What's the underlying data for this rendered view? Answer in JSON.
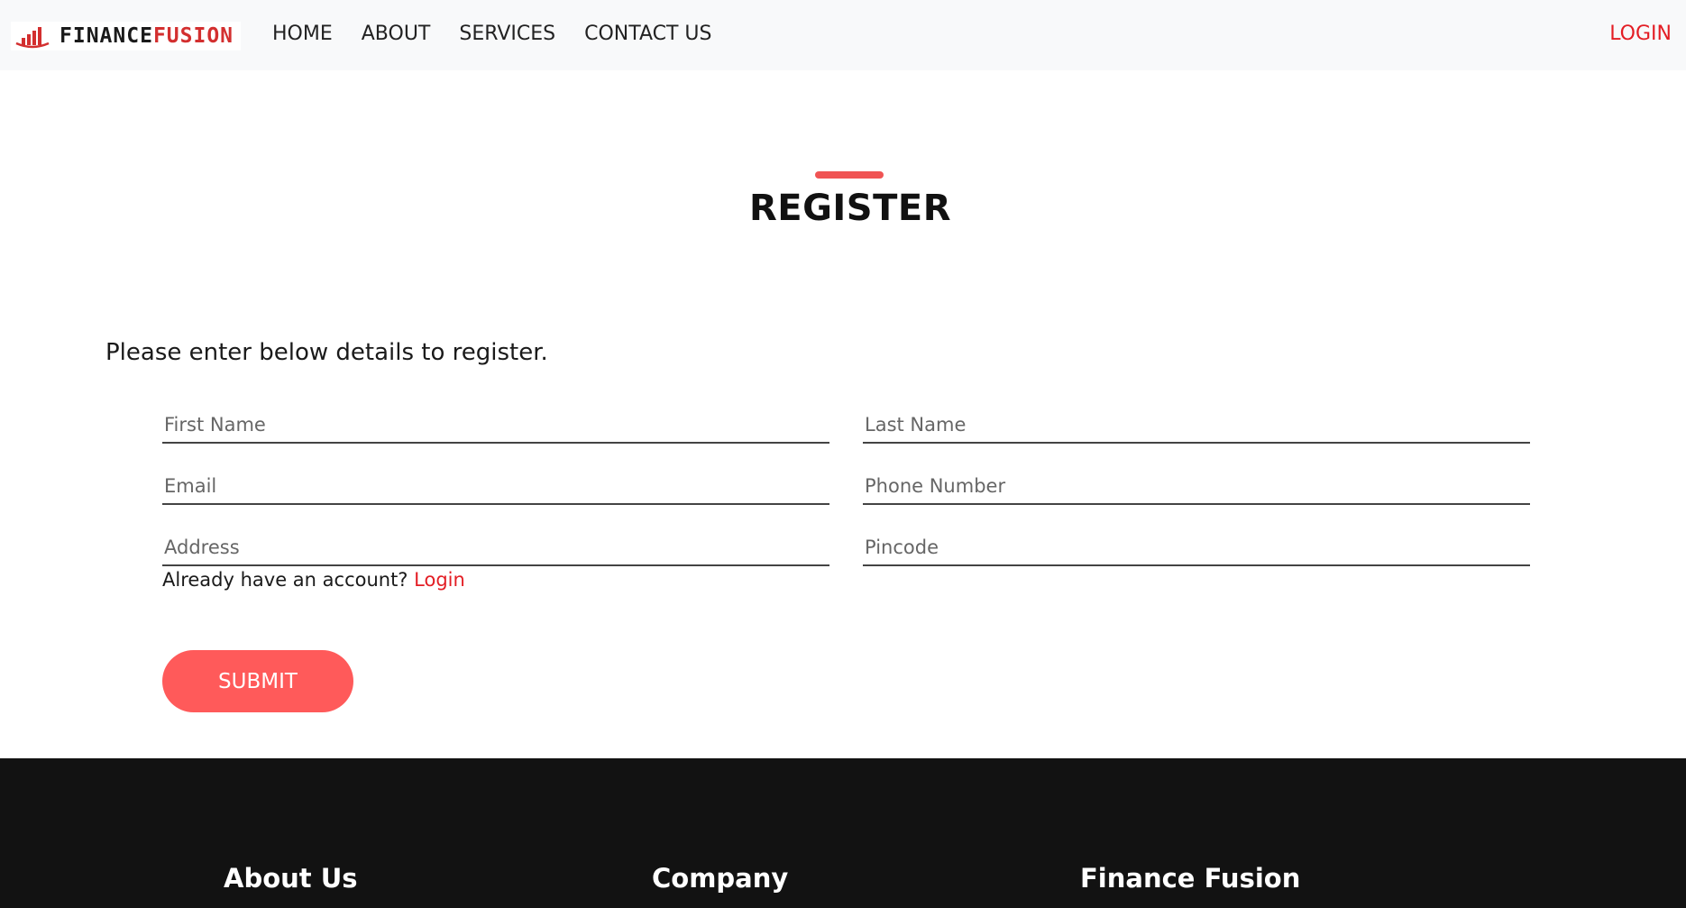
{
  "header": {
    "brand": {
      "part1": "FINANCE",
      "part2": "FUSION",
      "icon": "bar-chart-icon"
    },
    "nav": [
      "HOME",
      "ABOUT",
      "SERVICES",
      "CONTACT US"
    ],
    "login": "LOGIN"
  },
  "main": {
    "title": "REGISTER",
    "intro": "Please enter below details to register.",
    "fields": {
      "first_name": "First Name",
      "last_name": "Last Name",
      "email": "Email",
      "phone": "Phone Number",
      "address": "Address",
      "pincode": "Pincode"
    },
    "already_text": "Already have an account?",
    "login_link": "Login",
    "submit": "SUBMIT"
  },
  "footer": {
    "headings": [
      "About Us",
      "Company",
      "Finance Fusion"
    ]
  },
  "colors": {
    "accent": "#ff5a5a",
    "brand_red": "#e31d24",
    "footer_bg": "#121212",
    "navbar_bg": "#f8f9fa"
  }
}
